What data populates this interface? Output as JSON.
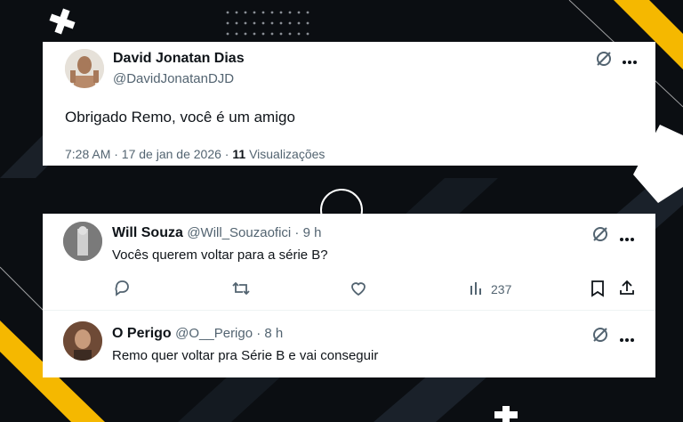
{
  "main_tweet": {
    "author_name": "David Jonatan Dias",
    "author_handle": "@DavidJonatanDJD",
    "text": "Obrigado Remo, você é um amigo",
    "timestamp": "7:28 AM · 17 de jan de 2026 ·",
    "views_count": "11",
    "views_label": "Visualizações"
  },
  "replies": [
    {
      "author_name": "Will Souza",
      "author_handle": "@Will_Souzaofici · 9 h",
      "text": "Vocês querem voltar para a série B?",
      "views": "237"
    },
    {
      "author_name": "O Perigo",
      "author_handle": "@O__Perigo · 8 h",
      "text": "Remo quer voltar pra Série B e vai conseguir"
    }
  ],
  "colors": {
    "background": "#0b0e12",
    "accent_yellow": "#f5b800",
    "text_primary": "#0f1419",
    "text_secondary": "#536471"
  }
}
